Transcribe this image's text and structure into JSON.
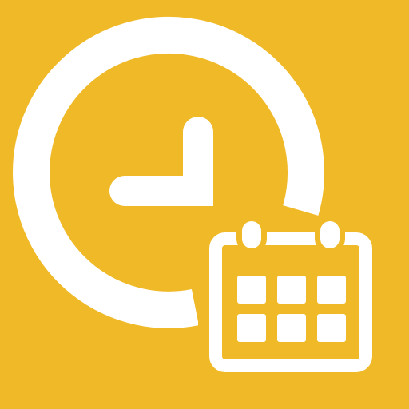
{
  "icon": {
    "background_color": "#F0B928",
    "foreground_color": "#FFFFFF",
    "glyphs": [
      "clock-icon",
      "calendar-icon"
    ]
  }
}
